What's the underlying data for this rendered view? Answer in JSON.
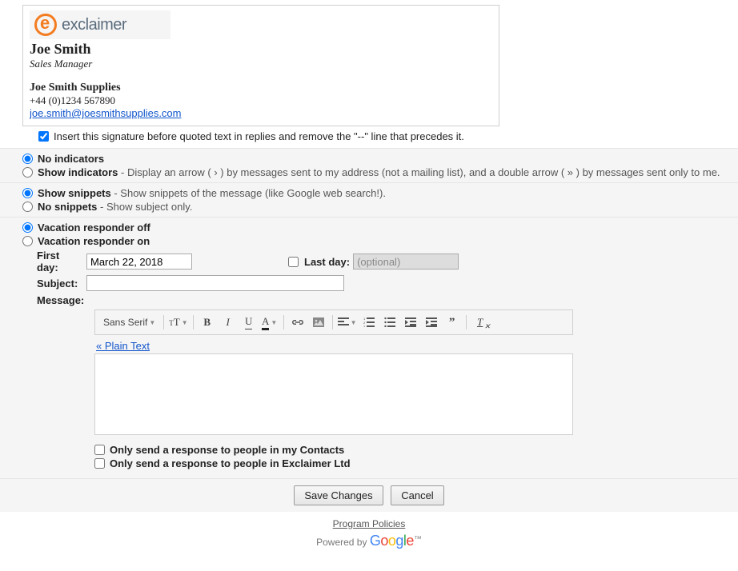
{
  "signature": {
    "brand": "exclaimer",
    "name": "Joe Smith",
    "title": "Sales Manager",
    "company": "Joe Smith Supplies",
    "phone": "+44 (0)1234 567890",
    "email": "joe.smith@joesmithsupplies.com",
    "insert_before_quoted_label": "Insert this signature before quoted text in replies and remove the \"--\" line that precedes it."
  },
  "indicators": {
    "none_label": "No indicators",
    "show_label": "Show indicators",
    "show_desc": " - Display an arrow ( › ) by messages sent to my address (not a mailing list), and a double arrow ( » ) by messages sent only to me."
  },
  "snippets": {
    "show_label": "Show snippets",
    "show_desc": " - Show snippets of the message (like Google web search!).",
    "hide_label": "No snippets",
    "hide_desc": " - Show subject only."
  },
  "vacation": {
    "off_label": "Vacation responder off",
    "on_label": "Vacation responder on",
    "first_day_label": "First day:",
    "first_day_value": "March 22, 2018",
    "last_day_label": "Last day:",
    "last_day_placeholder": "(optional)",
    "subject_label": "Subject:",
    "message_label": "Message:",
    "font_selector": "Sans Serif",
    "plain_text_link": "« Plain Text",
    "contacts_only_label": "Only send a response to people in my Contacts",
    "domain_only_label": "Only send a response to people in Exclaimer Ltd"
  },
  "buttons": {
    "save": "Save Changes",
    "cancel": "Cancel"
  },
  "footer": {
    "policies": "Program Policies",
    "powered_by": "Powered by "
  }
}
